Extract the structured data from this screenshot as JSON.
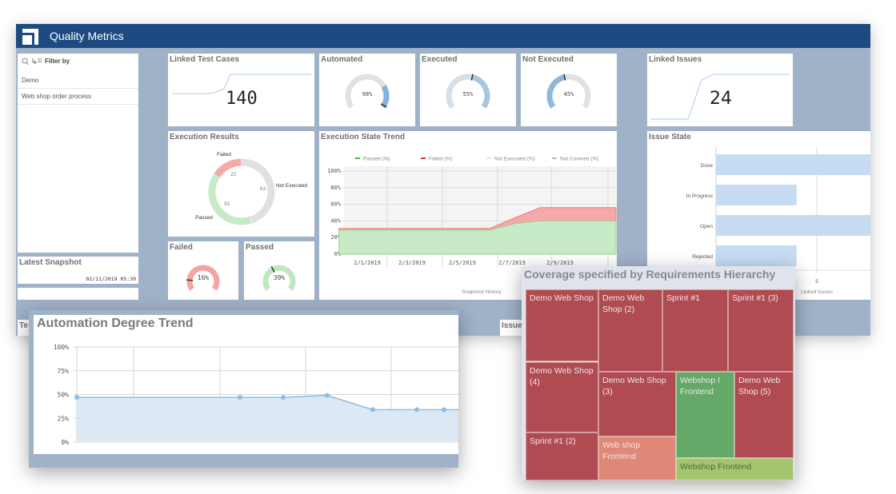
{
  "app": {
    "title": "Quality Metrics"
  },
  "filter": {
    "label": "Filter by",
    "items": [
      "Demo",
      "Web shop order process"
    ]
  },
  "snapshot": {
    "title": "Latest Snapshot",
    "value": "02/11/2019 05:30"
  },
  "kpis": {
    "linked_test_cases": {
      "title": "Linked Test Cases",
      "value": "140"
    },
    "linked_issues": {
      "title": "Linked Issues",
      "value": "24"
    }
  },
  "gauges": [
    {
      "title": "Automated",
      "value": 98,
      "label": "98%",
      "color": "#7aaedc"
    },
    {
      "title": "Executed",
      "value": 55,
      "label": "55%",
      "color": "#7aaedc"
    },
    {
      "title": "Not Executed",
      "value": 45,
      "label": "45%",
      "color": "#7aaedc"
    },
    {
      "title": "Failed",
      "value": 16,
      "label": "16%",
      "color": "#f4a4a4"
    },
    {
      "title": "Passed",
      "value": 39,
      "label": "39%",
      "color": "#bfe8c0"
    }
  ],
  "bottom_tabs": {
    "left": "Te",
    "right": "Issue"
  },
  "chart_data": [
    {
      "type": "pie",
      "title": "Execution Results",
      "categories": [
        "Not Executed",
        "Passed",
        "Failed"
      ],
      "values": [
        63,
        55,
        22
      ],
      "colors": [
        "#e0e0e0",
        "#c7eac7",
        "#f7a8a8"
      ]
    },
    {
      "type": "area",
      "title": "Execution State Trend",
      "xlabel": "Snapshot History",
      "ylim": [
        0,
        100
      ],
      "yticks": [
        "0%",
        "20%",
        "40%",
        "60%",
        "80%",
        "100%"
      ],
      "xticks": [
        "2/1/2019",
        "2/3/2019",
        "2/5/2019",
        "2/7/2019",
        "2/9/2019"
      ],
      "legend": [
        "Passed (%)",
        "Failed (%)",
        "Not Executed (%)",
        "Not Covered (%)"
      ],
      "legend_colors": [
        "#3cc43c",
        "#e83030",
        "#e0e0e0",
        "#bdbdbd"
      ],
      "x": [
        "1/31/2019",
        "2/6/2019",
        "2/7/2019",
        "2/8/2019",
        "2/11/2019"
      ],
      "series": [
        {
          "name": "Passed (%)",
          "values": [
            29,
            29,
            37,
            40,
            40
          ]
        },
        {
          "name": "Failed (%)",
          "values": [
            2,
            2,
            7,
            16,
            16
          ]
        }
      ]
    },
    {
      "type": "bar",
      "orientation": "horizontal",
      "title": "Issue State",
      "categories": [
        "Done",
        "In Progress",
        "Open",
        "Rejected"
      ],
      "values": [
        8,
        4,
        8,
        4
      ],
      "xlabel": "Linked Issues",
      "xticks": [
        "5"
      ],
      "color": "#c5dcf2"
    },
    {
      "type": "area",
      "title": "Automation Degree Trend",
      "ylim": [
        0,
        100
      ],
      "yticks": [
        "0%",
        "25%",
        "50%",
        "75%",
        "100%"
      ],
      "values": [
        47,
        47,
        47,
        49,
        34,
        34,
        34
      ],
      "color": "#8dbce4"
    },
    {
      "type": "treemap",
      "title": "Coverage specified by Requirements Hierarchy",
      "tiles": [
        {
          "label": "Demo Web Shop",
          "color": "#b04b52"
        },
        {
          "label": "Demo Web Shop (4)",
          "color": "#b04b52"
        },
        {
          "label": "Sprint #1 (2)",
          "color": "#b04b52"
        },
        {
          "label": "Demo Web Shop (2)",
          "color": "#b04b52"
        },
        {
          "label": "Sprint #1",
          "color": "#b04b52"
        },
        {
          "label": "Sprint #1 (3)",
          "color": "#b04b52"
        },
        {
          "label": "Demo Web Shop (3)",
          "color": "#b04b52"
        },
        {
          "label": "Web shop Frontend",
          "color": "#e08878"
        },
        {
          "label": "Webshop I Frontend",
          "color": "#64a968"
        },
        {
          "label": "Demo Web Shop (5)",
          "color": "#b04b52"
        },
        {
          "label": "Webshop Frontend",
          "color": "#a4c46e"
        }
      ]
    }
  ]
}
